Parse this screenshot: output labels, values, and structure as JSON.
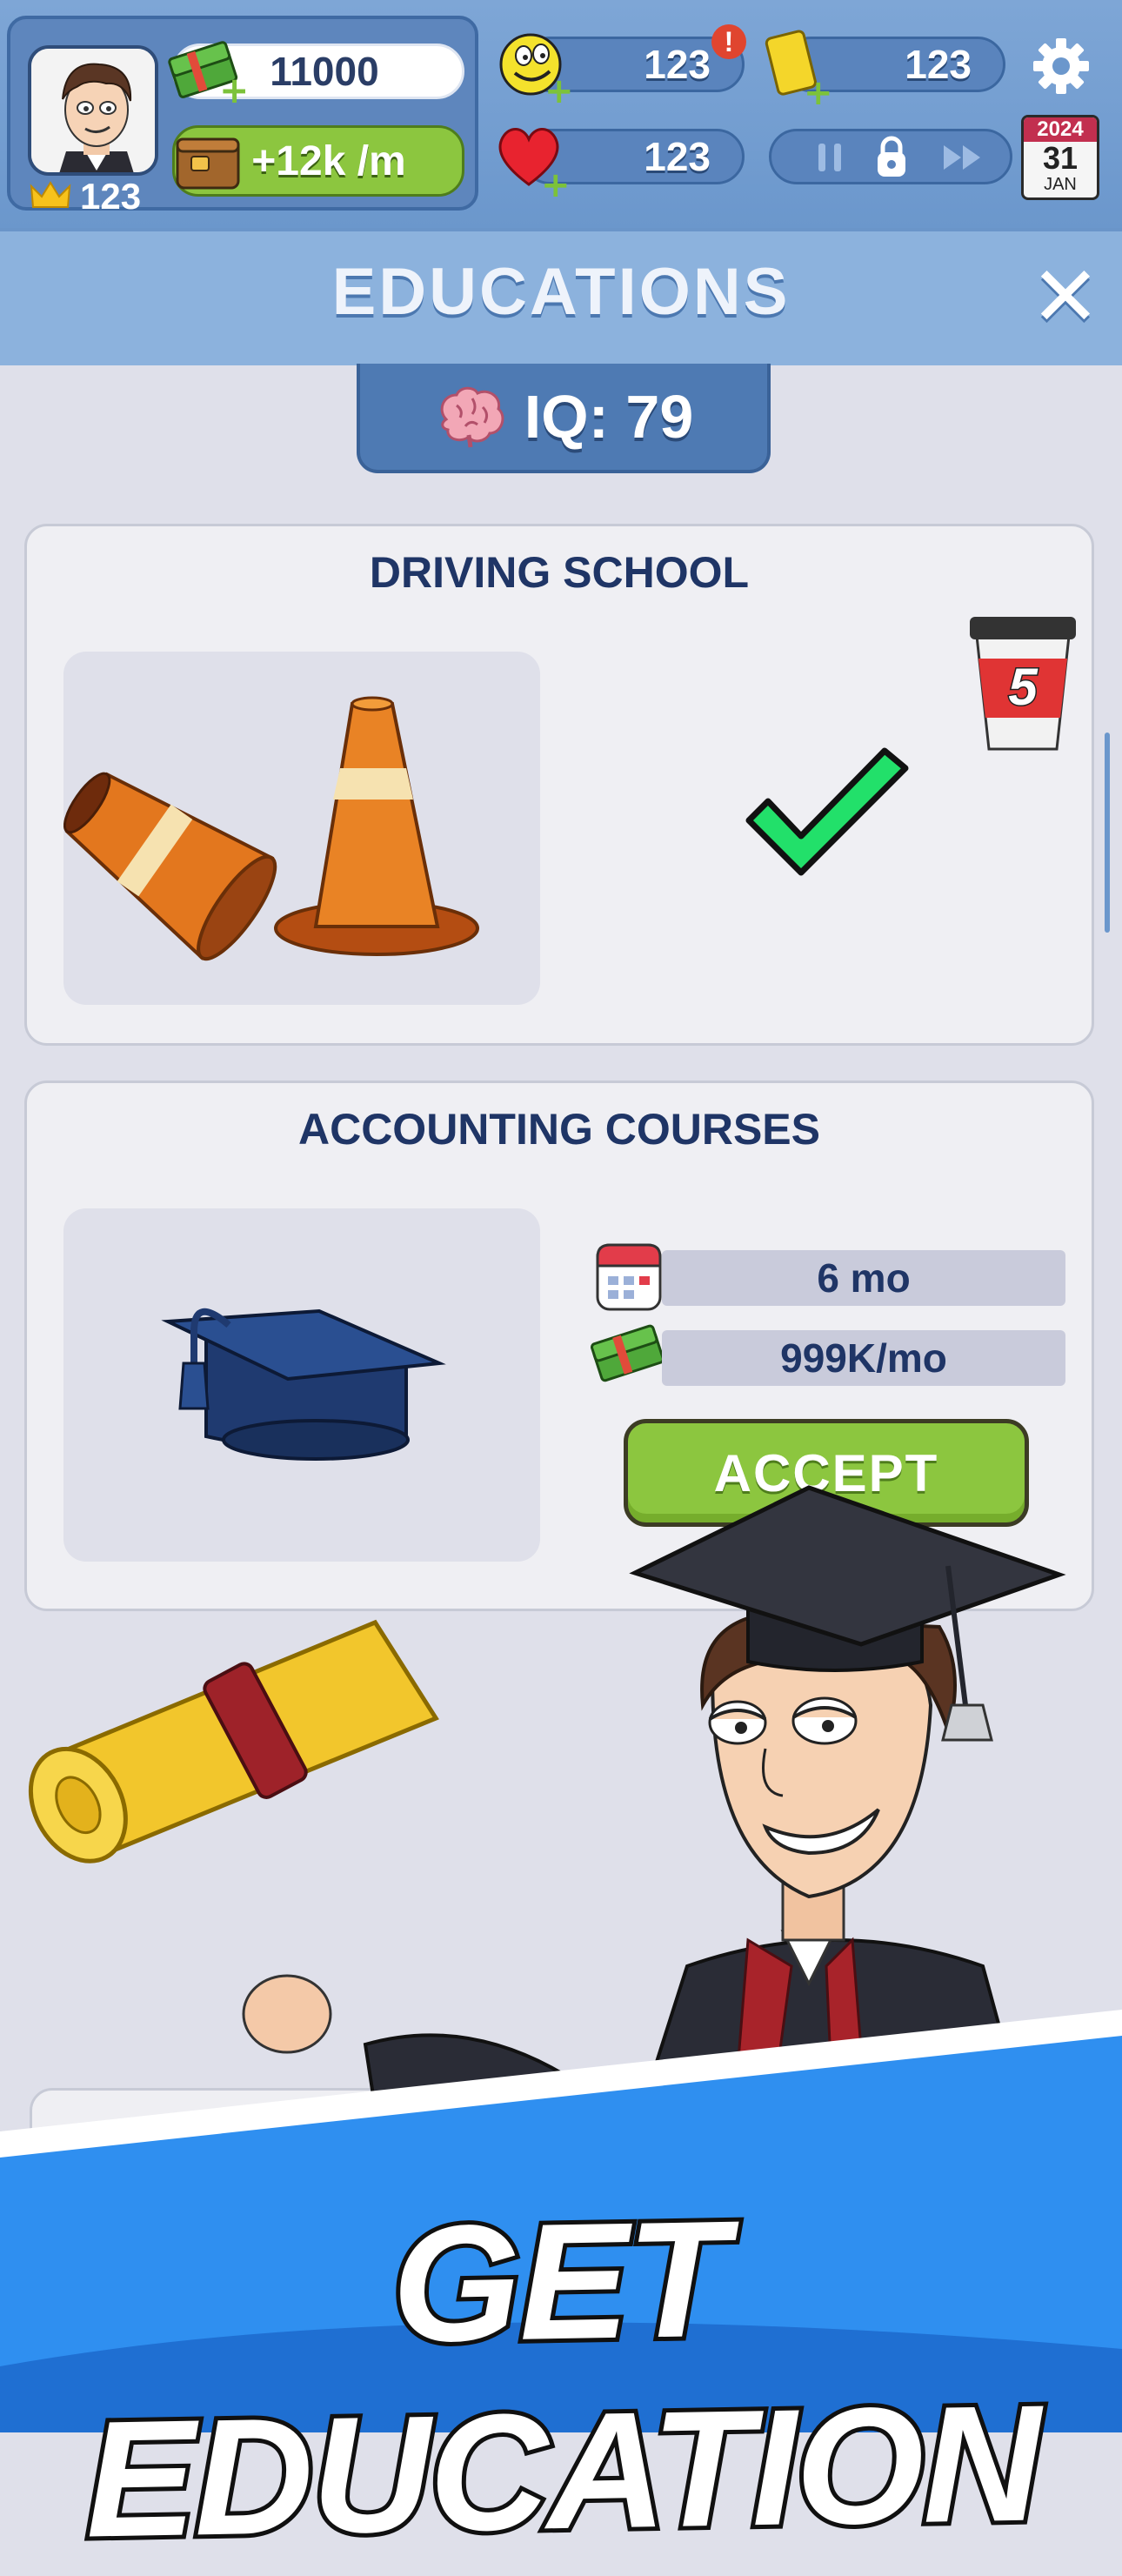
{
  "hud": {
    "level": "123",
    "cash": "11000",
    "income": "+12k /m",
    "happiness": "123",
    "happiness_alert": "!",
    "cards": "123",
    "health": "123",
    "calendar": {
      "year": "2024",
      "day": "31",
      "month": "JAN"
    },
    "icons": [
      "crown-icon",
      "cash-icon",
      "wallet-icon",
      "smiley-icon",
      "card-icon",
      "heart-icon",
      "settings-icon",
      "pause-icon",
      "lock-icon",
      "fast-forward-icon",
      "calendar-icon"
    ]
  },
  "header": {
    "title": "EDUCATIONS",
    "close": "✕"
  },
  "iq": {
    "label": "IQ: 79"
  },
  "courses": [
    {
      "title": "DRIVING SCHOOL",
      "status": "completed",
      "badge_number": "5"
    },
    {
      "title": "ACCOUNTING COURSES",
      "duration": "6 mo",
      "cost": "999K/mo",
      "accept_label": "ACCEPT"
    }
  ],
  "banner": {
    "text": "GET EDUCATION"
  },
  "colors": {
    "hud_blue": "#6b97cc",
    "navy_text": "#1f3566",
    "green_button": "#8cc63f",
    "banner_blue": "#2f8ff0"
  }
}
